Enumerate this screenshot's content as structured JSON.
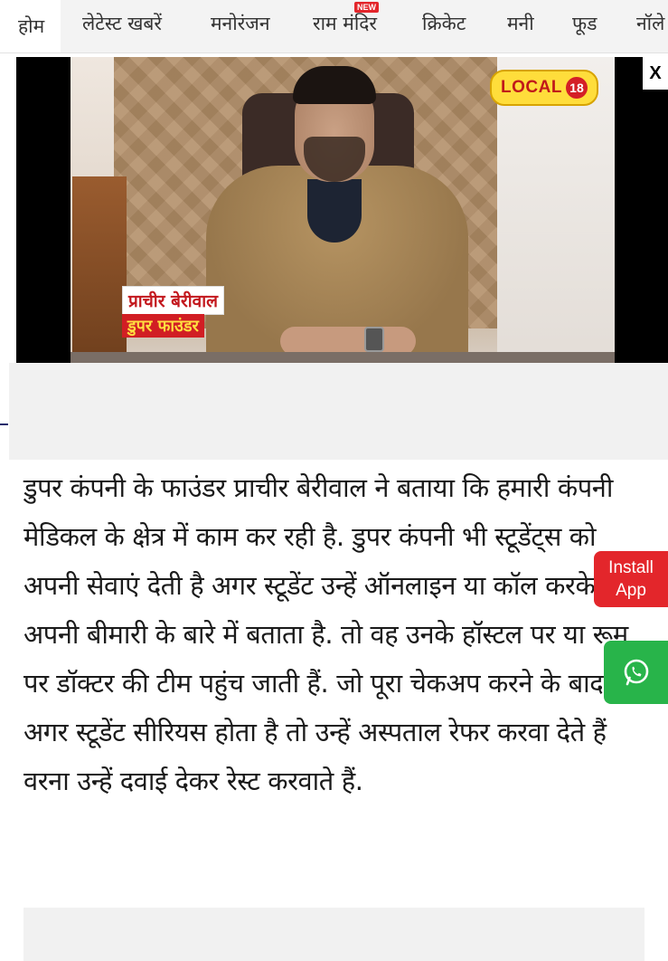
{
  "nav": {
    "items": [
      {
        "label": "होम"
      },
      {
        "label": "लेटेस्ट खबरें"
      },
      {
        "label": "मनोरंजन"
      },
      {
        "label": "राम मंदिर",
        "badge": "NEW"
      },
      {
        "label": "क्रिकेट"
      },
      {
        "label": "मनी"
      },
      {
        "label": "फूड"
      },
      {
        "label": "नॉले"
      }
    ]
  },
  "video": {
    "channel_logo": "LOCAL",
    "channel_number": "18",
    "caption_name": "प्राचीर बेरीवाल",
    "caption_role": "डुपर फाउंडर",
    "close_label": "X"
  },
  "article": {
    "text": "डुपर कंपनी के फाउंडर प्राचीर बेरीवाल ने बताया कि हमारी कंपनी मेडिकल के क्षेत्र में काम कर रही है. डुपर कंपनी भी स्टूडेंट्स को अपनी सेवाएं देती है अगर स्टूडेंट उन्हें ऑनलाइन या कॉल करके अपनी बीमारी के बारे में बताता है. तो वह उनके हॉस्टल पर या रूम पर डॉक्टर की टीम पहुंच जाती हैं. जो पूरा चेकअप करने के बाद अगर स्टूडेंट सीरियस होता है तो उन्हें अस्पताल रेफर करवा देते हैं वरना उन्हें दवाई देकर रेस्ट करवाते हैं."
  },
  "floating": {
    "install_line1": "Install",
    "install_line2": "App",
    "whatsapp_icon": "whatsapp-icon"
  },
  "colors": {
    "accent_red": "#e3262b",
    "whatsapp_green": "#28b44a"
  }
}
